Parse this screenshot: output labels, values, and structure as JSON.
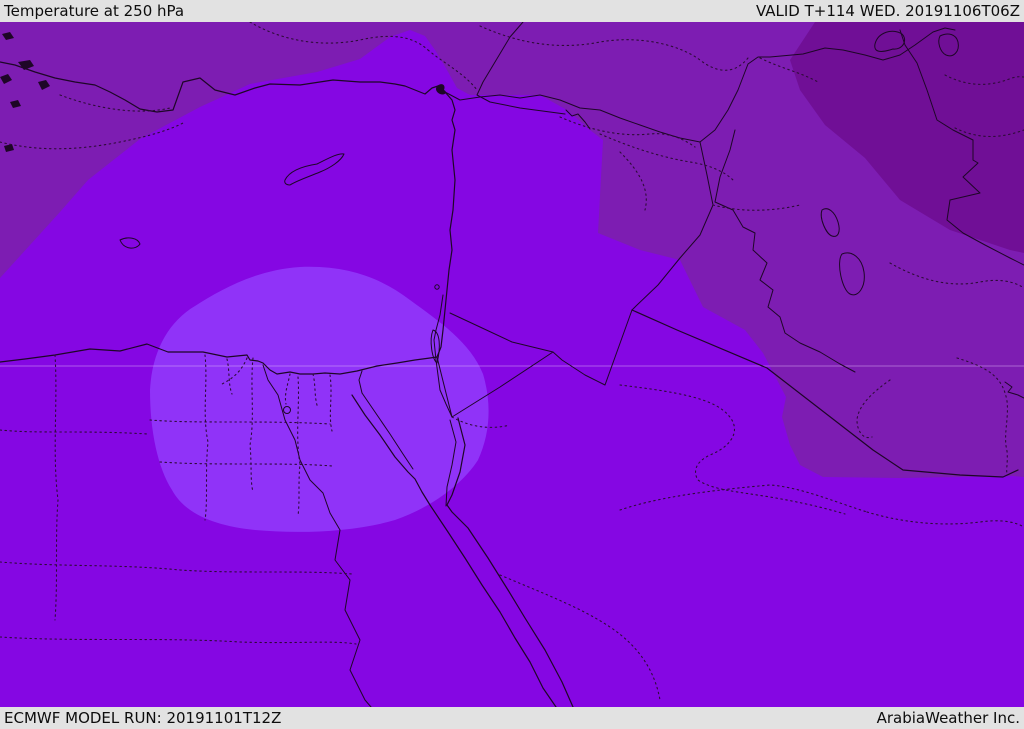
{
  "header": {
    "title": "Temperature at 250 hPa",
    "valid_label": "VALID T+114 WED. 20191106T06Z"
  },
  "footer": {
    "model_run_label": "ECMWF MODEL RUN: 20191101T12Z",
    "brand_label": "ArabiaWeather Inc."
  },
  "colors": {
    "bar_bg": "#e2e2e2",
    "bar_text": "#0d0d0d",
    "temp_mid": "#8507E3",
    "temp_warm": "#9033F8",
    "temp_cool": "#7D1DB2",
    "temp_coolest": "#700F96",
    "coast": "#1e0627",
    "admin": "#2e0b38",
    "gridline": "#e3bcf8"
  },
  "map": {
    "type": "weather-map",
    "parameter": "Temperature",
    "level": "250 hPa",
    "model": "ECMWF",
    "region_bands": [
      {
        "name": "warm-anomaly-egypt-sinai",
        "color_key": "temp_warm"
      },
      {
        "name": "main-violet-band",
        "color_key": "temp_mid"
      },
      {
        "name": "cooler-band-turkey-iraq",
        "color_key": "temp_cool"
      },
      {
        "name": "coolest-pocket-nw-iran",
        "color_key": "temp_coolest"
      }
    ]
  }
}
